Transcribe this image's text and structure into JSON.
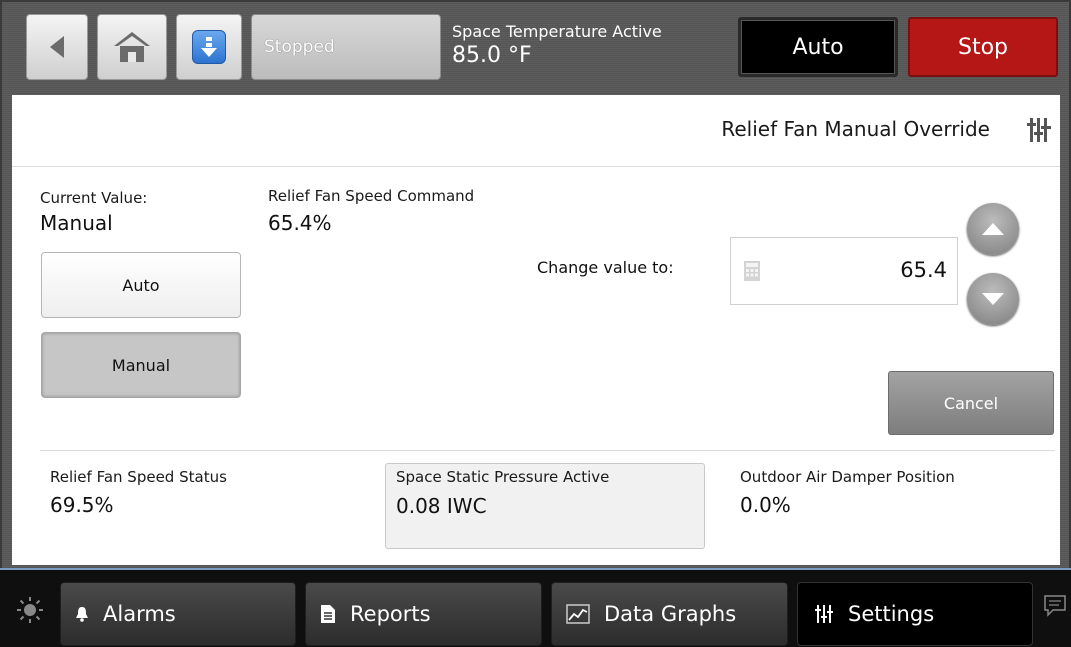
{
  "topbar": {
    "status_label": "Stopped",
    "space_temp_label": "Space Temperature Active",
    "space_temp_value": "85.0 °F",
    "auto_label": "Auto",
    "stop_label": "Stop"
  },
  "panel": {
    "title": "Relief Fan Manual Override",
    "current_value_label": "Current Value:",
    "current_value": "Manual",
    "command_label": "Relief Fan Speed Command",
    "command_value": "65.4%",
    "auto_button": "Auto",
    "manual_button": "Manual",
    "change_label": "Change value to:",
    "input_value": "65.4",
    "cancel_button": "Cancel"
  },
  "status": [
    {
      "label": "Relief Fan Speed Status",
      "value": "69.5%"
    },
    {
      "label": "Space Static Pressure Active",
      "value": "0.08 IWC"
    },
    {
      "label": "Outdoor Air Damper Position",
      "value": "0.0%"
    }
  ],
  "nav": {
    "alarms": "Alarms",
    "reports": "Reports",
    "graphs": "Data Graphs",
    "settings": "Settings"
  },
  "colors": {
    "stop_red": "#b51717",
    "accent_blue": "#2e74cf",
    "bottom_bar": "#0f0f0f"
  },
  "icons": [
    "back-arrow-icon",
    "home-icon",
    "download-icon",
    "sliders-icon",
    "calculator-icon",
    "chevron-up-icon",
    "chevron-down-icon",
    "sun-icon",
    "bell-icon",
    "document-icon",
    "line-chart-icon",
    "chat-icon"
  ]
}
